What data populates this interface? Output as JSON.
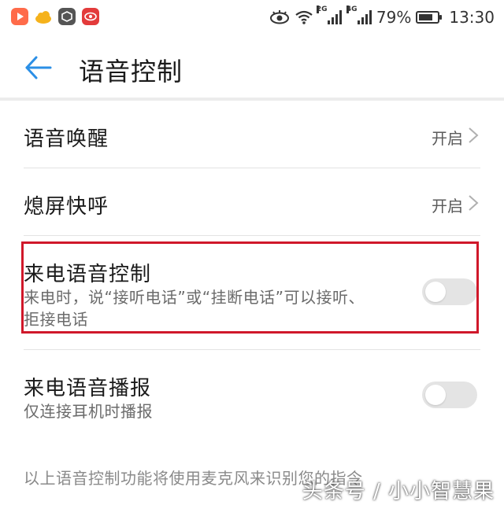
{
  "status_bar": {
    "battery_percent": "79%",
    "battery_level": 0.79,
    "time": "13:30",
    "sim1_tag": "2G",
    "sim2_tag": "4G",
    "app_icons": [
      "video-app-icon",
      "cloud-app-icon",
      "box-app-icon",
      "eye-app-icon"
    ]
  },
  "header": {
    "title": "语音控制"
  },
  "settings": {
    "voice_wakeup": {
      "label": "语音唤醒",
      "value": "开启"
    },
    "screen_off_call": {
      "label": "熄屏快呼",
      "value": "开启"
    },
    "incoming_voice_control": {
      "label": "来电语音控制",
      "description": "来电时，说“接听电话”或“挂断电话”可以接听、拒接电话",
      "enabled": false
    },
    "incoming_voice_announce": {
      "label": "来电语音播报",
      "description": "仅连接耳机时播报",
      "enabled": false
    }
  },
  "footer": {
    "note": "以上语音控制功能将使用麦克风来识别您的指令"
  },
  "watermark": "头条号 / 小小智慧果",
  "colors": {
    "accent": "#2b8fe6",
    "highlight": "#d0182a"
  }
}
